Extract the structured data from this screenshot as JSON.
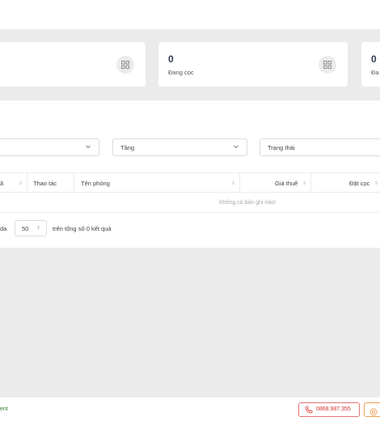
{
  "stats": [
    {
      "value": "0",
      "label": "",
      "icon": "grid-icon"
    },
    {
      "value": "0",
      "label": "Đang cọc",
      "icon": "grid-icon"
    },
    {
      "value": "0",
      "label": "Đa",
      "icon": "grid-icon"
    }
  ],
  "filters": {
    "first": {
      "label": ""
    },
    "floor": {
      "label": "Tầng"
    },
    "status": {
      "label": "Trạng thái"
    }
  },
  "table": {
    "columns": [
      "ã",
      "Thao tác",
      "Tên phòng",
      "Giá thuê",
      "Đặt cọc"
    ],
    "empty_text": "Không có bản ghi nào!"
  },
  "pagination": {
    "prefix": "da",
    "page_size": "50",
    "suffix": "trên tổng số 0 kết quả"
  },
  "footer": {
    "brand": "ent",
    "phone": "0868.987.355"
  },
  "colors": {
    "phone_border": "#e57373",
    "phone_text": "#d32f2f",
    "brand_text": "#2e7d32",
    "support_border": "#f0a050"
  }
}
